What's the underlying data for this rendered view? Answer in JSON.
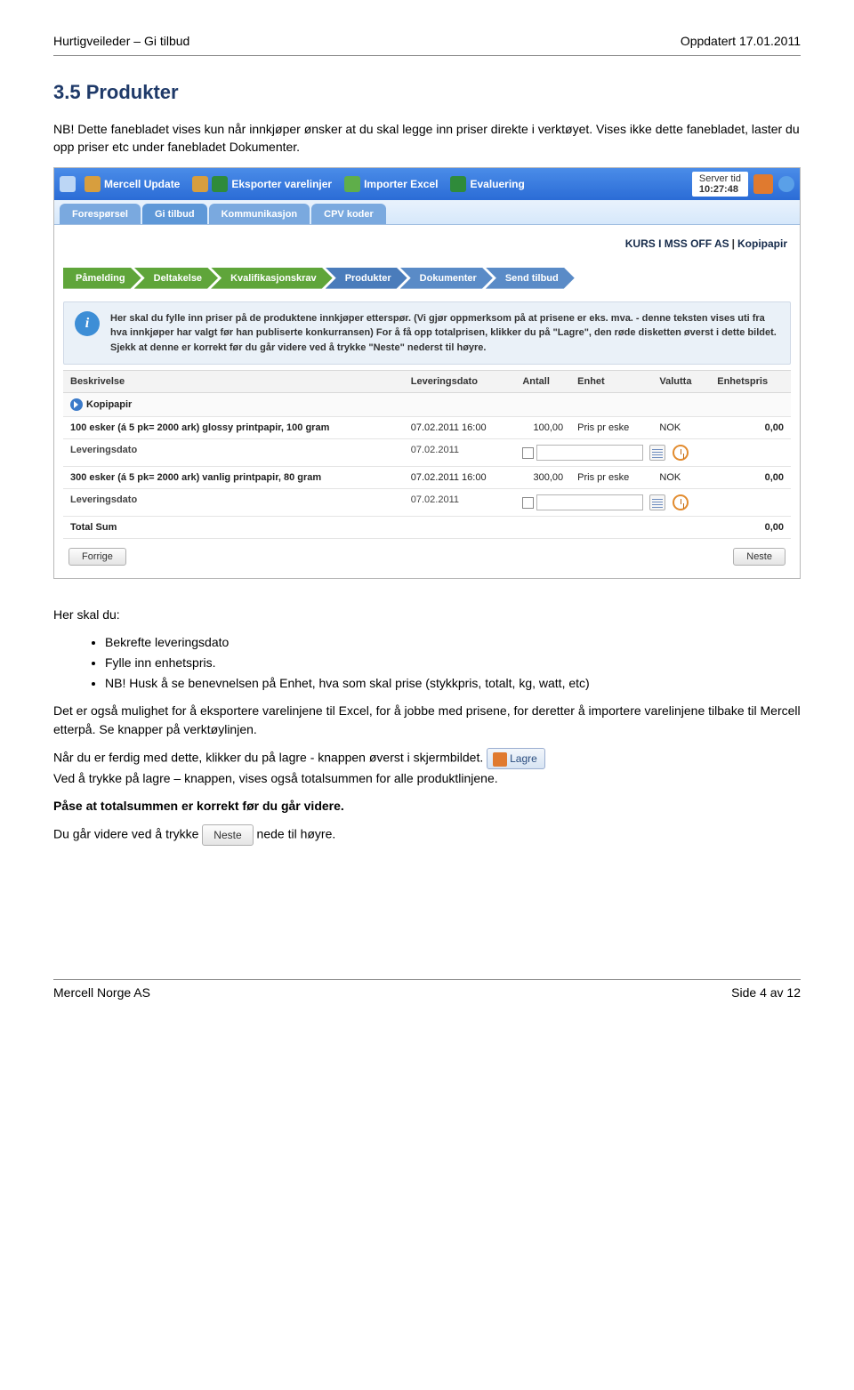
{
  "doc": {
    "header_left": "Hurtigveileder – Gi tilbud",
    "header_right": "Oppdatert 17.01.2011",
    "section_title": "3.5  Produkter",
    "intro": "NB! Dette fanebladet vises kun når innkjøper ønsker at du skal legge inn priser direkte i verktøyet. Vises ikke dette fanebladet, laster du opp priser etc under fanebladet Dokumenter.",
    "footer_left": "Mercell Norge AS",
    "footer_right": "Side 4 av 12"
  },
  "toolbar": {
    "update": "Mercell Update",
    "export_lines": "Eksporter varelinjer",
    "import_excel": "Importer Excel",
    "evaluate": "Evaluering",
    "server_time_label": "Server tid",
    "server_time_value": "10:27:48"
  },
  "tabs": [
    "Forespørsel",
    "Gi tilbud",
    "Kommunikasjon",
    "CPV koder"
  ],
  "breadcrumb": {
    "left": "KURS I MSS OFF AS",
    "right": "Kopipapir"
  },
  "wizard": [
    "Påmelding",
    "Deltakelse",
    "Kvalifikasjonskrav",
    "Produkter",
    "Dokumenter",
    "Send tilbud"
  ],
  "info_text": "Her skal du fylle inn priser på de produktene innkjøper etterspør. (Vi gjør oppmerksom på at prisene er eks. mva. - denne teksten vises uti fra hva innkjøper har valgt før han publiserte konkurransen) For å få opp totalprisen, klikker du på \"Lagre\", den røde disketten øverst i dette bildet. Sjekk at denne er korrekt før du går videre ved å trykke \"Neste\" nederst til høyre.",
  "table": {
    "headers": [
      "Beskrivelse",
      "Leveringsdato",
      "Antall",
      "Enhet",
      "Valutta",
      "Enhetspris"
    ],
    "group": "Kopipapir",
    "rows": [
      {
        "desc": "100 esker (á 5 pk= 2000 ark) glossy printpapir, 100 gram",
        "date": "07.02.2011 16:00",
        "qty": "100,00",
        "unit": "Pris pr eske",
        "currency": "NOK",
        "price": "0,00",
        "sub_label": "Leveringsdato",
        "sub_date": "07.02.2011"
      },
      {
        "desc": "300 esker (á 5 pk= 2000 ark) vanlig printpapir, 80 gram",
        "date": "07.02.2011 16:00",
        "qty": "300,00",
        "unit": "Pris pr eske",
        "currency": "NOK",
        "price": "0,00",
        "sub_label": "Leveringsdato",
        "sub_date": "07.02.2011"
      }
    ],
    "total_label": "Total Sum",
    "total_value": "0,00"
  },
  "buttons": {
    "prev": "Forrige",
    "next": "Neste"
  },
  "after": {
    "intro": "Her skal du:",
    "bullets": [
      "Bekrefte leveringsdato",
      "Fylle inn enhetspris.",
      "NB! Husk å se benevnelsen på Enhet, hva som skal prise (stykkpris, totalt, kg, watt, etc)"
    ],
    "p2": "Det er også mulighet for å eksportere varelinjene til Excel, for å jobbe med prisene, for deretter å importere varelinjene tilbake til Mercell etterpå. Se knapper på verktøylinjen.",
    "p3a": "Når du er ferdig med dette, klikker du på lagre - knappen øverst i skjermbildet.",
    "lagre_label": "Lagre",
    "p3b": "Ved å trykke på lagre – knappen, vises også totalsummen for alle produktlinjene.",
    "p4": "Påse at totalsummen er korrekt før du går videre.",
    "p5a": "Du går videre ved å trykke",
    "neste_label": "Neste",
    "p5b": "nede til høyre."
  }
}
